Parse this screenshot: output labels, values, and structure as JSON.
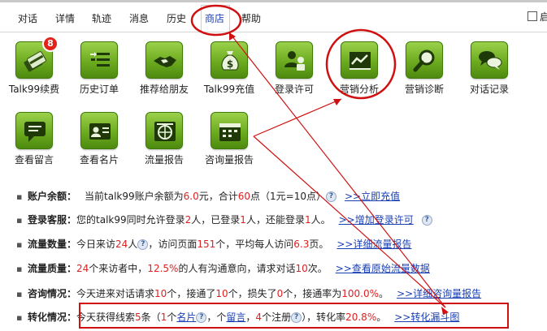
{
  "tabs": [
    {
      "label": "对话"
    },
    {
      "label": "详情"
    },
    {
      "label": "轨迹"
    },
    {
      "label": "消息"
    },
    {
      "label": "历史"
    },
    {
      "label": "商店"
    },
    {
      "label": "帮助"
    }
  ],
  "active_tab": "商店",
  "right_checkbox_label": "启",
  "apps": [
    {
      "label": "Talk99续费",
      "icon": "card-icon",
      "badge": "8"
    },
    {
      "label": "历史订单",
      "icon": "list-icon"
    },
    {
      "label": "推荐给朋友",
      "icon": "handshake-icon"
    },
    {
      "label": "Talk99充值",
      "icon": "money-bag-icon"
    },
    {
      "label": "登录许可",
      "icon": "user-key-icon"
    },
    {
      "label": "营销分析",
      "icon": "chart-icon"
    },
    {
      "label": "营销诊断",
      "icon": "magnifier-icon"
    },
    {
      "label": "对话记录",
      "icon": "chat-bubbles-icon"
    },
    {
      "label": "查看留言",
      "icon": "message-icon"
    },
    {
      "label": "查看名片",
      "icon": "card-id-icon"
    },
    {
      "label": "流量报告",
      "icon": "globe-icon"
    },
    {
      "label": "咨询量报告",
      "icon": "calendar-icon"
    }
  ],
  "info": {
    "balance": {
      "label": "账户余额：",
      "t1": "当前talk99账户余额为",
      "v1": "6.0",
      "t2": "元，合计",
      "v2": "60",
      "t3": "点（1元=10点）",
      "link": ">>立即充值"
    },
    "login": {
      "label": "登录客服：",
      "t1": "您的talk99同时允许登录",
      "v1": "2",
      "t2": "人，已登录",
      "v2": "1",
      "t3": "人，还能登录",
      "v3": "1",
      "t4": "人。",
      "link": ">>增加登录许可"
    },
    "traffic": {
      "label": "流量数量：",
      "t1": "今日来访",
      "v1": "24",
      "t2": "人",
      "t3": "，访问页面",
      "v2": "151",
      "t4": "个，平均每人访问",
      "v3": "6.3",
      "t5": "页。",
      "link": ">>详细流量报告"
    },
    "quality": {
      "label": "流量质量：",
      "v1": "24",
      "t1": "个来访者中，",
      "v2": "12.5%",
      "t2": "的人有沟通意向，请求对话",
      "v3": "10",
      "t3": "次。",
      "link": ">>查看原始流量数据"
    },
    "consult": {
      "label": "咨询情况：",
      "t1": "今天进来对话请求",
      "v1": "10",
      "t2": "个，接通了",
      "v2": "10",
      "t3": "个，损失了",
      "v3": "0",
      "t4": "个，接通率为",
      "v4": "100.0%",
      "t5": "。",
      "link": ">>详细咨询量报告"
    },
    "conversion": {
      "label": "转化情况：",
      "t1": "今天获得线索",
      "v1": "5",
      "t2": "条（",
      "v2": "1",
      "t3": "个",
      "link1": "名片",
      "t4": "，",
      "t5": "个",
      "link2": "留言",
      "t6": "，",
      "v3": "4",
      "t7": "个注册",
      "t8": "），转化率",
      "v4": "20.8%",
      "t9": "。",
      "link": ">>转化漏斗图"
    }
  },
  "colors": {
    "icon_green": "#6cab1f",
    "link_blue": "#1a3fb3",
    "value_red": "#e02020",
    "annotation_red": "#d01010"
  }
}
